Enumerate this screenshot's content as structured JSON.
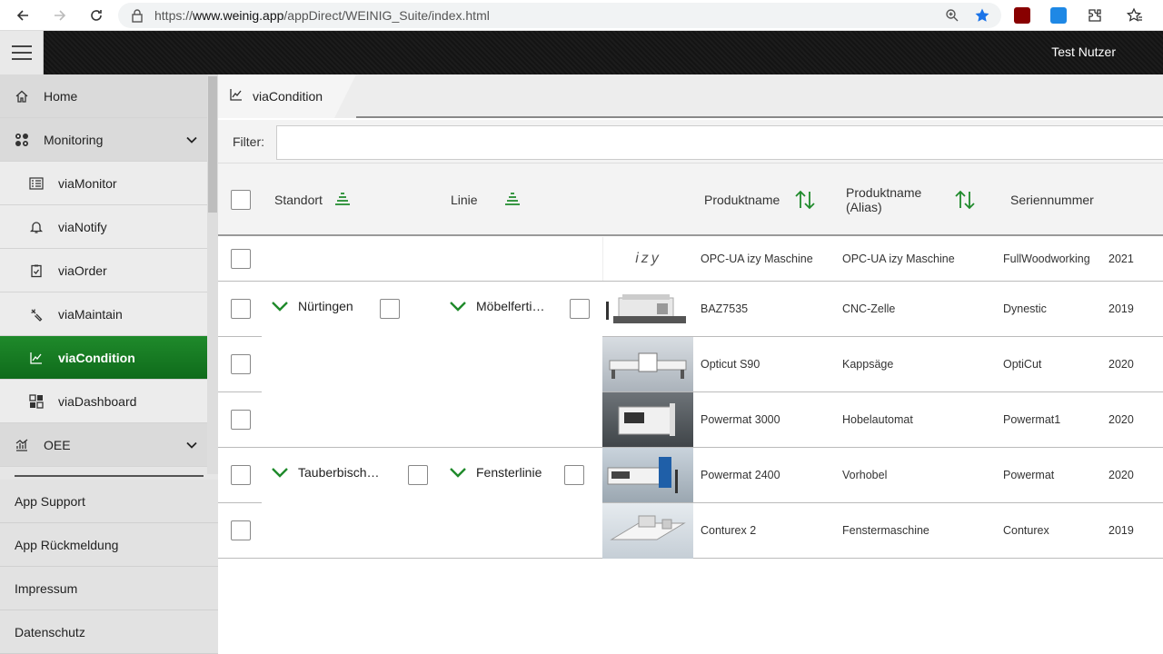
{
  "browser": {
    "url_prefix": "https://",
    "url_host": "www.weinig.app",
    "url_path": "/appDirect/WEINIG_Suite/index.html"
  },
  "header": {
    "user": "Test Nutzer"
  },
  "sidebar": {
    "items": [
      {
        "label": "Home",
        "icon": "home-icon"
      },
      {
        "label": "Monitoring",
        "icon": "monitoring-icon"
      },
      {
        "label": "viaMonitor",
        "icon": "list-icon"
      },
      {
        "label": "viaNotify",
        "icon": "bell-icon"
      },
      {
        "label": "viaOrder",
        "icon": "clipboard-icon"
      },
      {
        "label": "viaMaintain",
        "icon": "wrench-icon"
      },
      {
        "label": "viaCondition",
        "icon": "chart-line-icon"
      },
      {
        "label": "viaDashboard",
        "icon": "dashboard-icon"
      },
      {
        "label": "OEE",
        "icon": "oee-icon"
      }
    ],
    "links": [
      "App Support",
      "App Rückmeldung",
      "Impressum",
      "Datenschutz"
    ]
  },
  "tab": {
    "label": "viaCondition"
  },
  "filter": {
    "label": "Filter:",
    "value": ""
  },
  "table": {
    "columns": [
      "Standort",
      "Linie",
      "Produktname",
      "Produktname\n(Alias)",
      "Seriennummer"
    ],
    "groups": [
      {
        "standort": "Nürtingen",
        "linie": "Möbelferti…"
      },
      {
        "standort": "Tauberbisch…",
        "linie": "Fensterlinie"
      }
    ],
    "rows": [
      {
        "logo": "izy",
        "produkt": "OPC-UA izy Maschine",
        "alias": "OPC-UA izy Maschine",
        "serie": "FullWoodworking",
        "jahr": "2021"
      },
      {
        "produkt": "BAZ7535",
        "alias": "CNC-Zelle",
        "serie": "Dynestic",
        "jahr": "2019"
      },
      {
        "produkt": "Opticut S90",
        "alias": "Kappsäge",
        "serie": "OptiCut",
        "jahr": "2020"
      },
      {
        "produkt": "Powermat 3000",
        "alias": "Hobelautomat",
        "serie": "Powermat1",
        "jahr": "2020"
      },
      {
        "produkt": "Powermat 2400",
        "alias": "Vorhobel",
        "serie": "Powermat",
        "jahr": "2020"
      },
      {
        "produkt": "Conturex 2",
        "alias": "Fenstermaschine",
        "serie": "Conturex",
        "jahr": "2019"
      }
    ]
  },
  "colors": {
    "accent": "#1f8a2b",
    "header": "#161616"
  }
}
